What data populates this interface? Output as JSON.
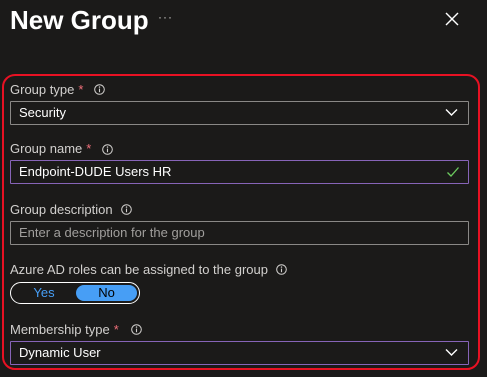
{
  "panel": {
    "title": "New Group",
    "more_label": "···"
  },
  "form": {
    "group_type": {
      "label": "Group type",
      "required_marker": "*",
      "value": "Security"
    },
    "group_name": {
      "label": "Group name",
      "required_marker": "*",
      "value": "Endpoint-DUDE Users HR"
    },
    "group_description": {
      "label": "Group description",
      "placeholder": "Enter a description for the group"
    },
    "azure_ad_roles": {
      "label": "Azure AD roles can be assigned to the group",
      "yes_label": "Yes",
      "no_label": "No",
      "selected": "No"
    },
    "membership_type": {
      "label": "Membership type",
      "required_marker": "*",
      "value": "Dynamic User"
    }
  },
  "colors": {
    "background": "#1b1a19",
    "highlight_border": "#e81123",
    "accent": "#479ef5",
    "focus_border": "#8764b8",
    "valid_check": "#6ccb5f"
  }
}
